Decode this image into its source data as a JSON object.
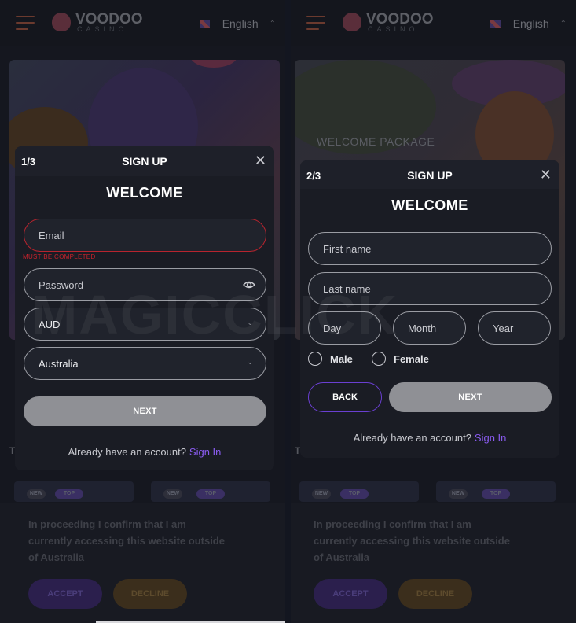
{
  "header": {
    "logo_text": "VOODOO",
    "logo_sub": "CASINO",
    "language": "English"
  },
  "hero": {
    "caption": "WELCOME PACKAGE"
  },
  "promo_badges": {
    "new": "NEW",
    "top": "TOP"
  },
  "modal_step1": {
    "step": "1/3",
    "title": "SIGN UP",
    "welcome": "WELCOME",
    "email_placeholder": "Email",
    "email_error": "MUST BE COMPLETED",
    "password_placeholder": "Password",
    "currency_value": "AUD",
    "country_value": "Australia",
    "next_label": "NEXT",
    "signin_prompt": "Already have an account?",
    "signin_link": "Sign In"
  },
  "modal_step2": {
    "step": "2/3",
    "title": "SIGN UP",
    "welcome": "WELCOME",
    "first_name_placeholder": "First name",
    "last_name_placeholder": "Last name",
    "day_placeholder": "Day",
    "month_placeholder": "Month",
    "year_placeholder": "Year",
    "male_label": "Male",
    "female_label": "Female",
    "back_label": "BACK",
    "next_label": "NEXT",
    "signin_prompt": "Already have an account?",
    "signin_link": "Sign In"
  },
  "consent": {
    "text": "In proceeding I confirm that I am currently accessing this website outside of Australia",
    "accept_label": "ACCEPT",
    "decline_label": "DECLINE"
  },
  "watermark": "MAGICCLICK",
  "edge_letter": "T",
  "colors": {
    "brand_purple": "#8a5cf0",
    "error_red": "#c8232c",
    "next_gray": "#8f9095",
    "panel_bg": "#15171f"
  }
}
